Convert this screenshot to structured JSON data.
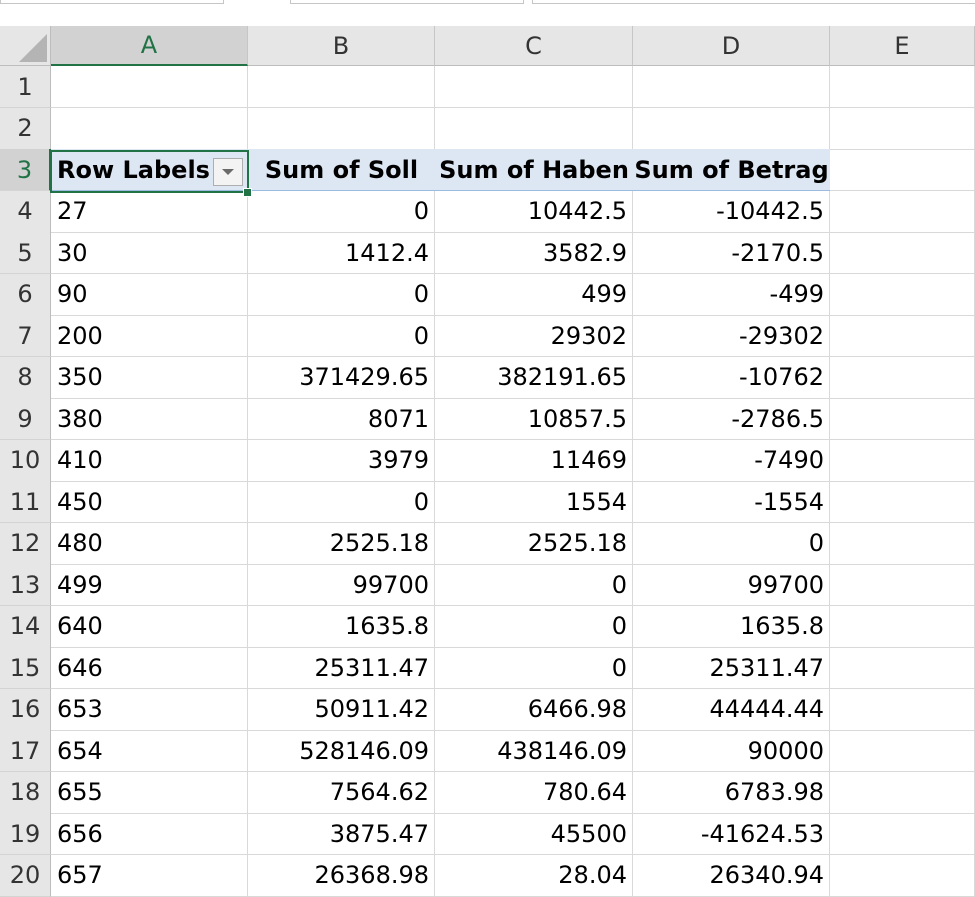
{
  "sheet": {
    "columns": [
      "A",
      "B",
      "C",
      "D",
      "E"
    ],
    "active_column": "A",
    "active_row": "3",
    "rows": [
      {
        "n": "1",
        "a": "",
        "b": "",
        "c": "",
        "d": ""
      },
      {
        "n": "2",
        "a": "",
        "b": "",
        "c": "",
        "d": ""
      },
      {
        "n": "3",
        "a": "Row Labels",
        "b": "Sum of Soll",
        "c": "Sum of Haben",
        "d": "Sum of Betrag"
      },
      {
        "n": "4",
        "a": "27",
        "b": "0",
        "c": "10442.5",
        "d": "-10442.5"
      },
      {
        "n": "5",
        "a": "30",
        "b": "1412.4",
        "c": "3582.9",
        "d": "-2170.5"
      },
      {
        "n": "6",
        "a": "90",
        "b": "0",
        "c": "499",
        "d": "-499"
      },
      {
        "n": "7",
        "a": "200",
        "b": "0",
        "c": "29302",
        "d": "-29302"
      },
      {
        "n": "8",
        "a": "350",
        "b": "371429.65",
        "c": "382191.65",
        "d": "-10762"
      },
      {
        "n": "9",
        "a": "380",
        "b": "8071",
        "c": "10857.5",
        "d": "-2786.5"
      },
      {
        "n": "10",
        "a": "410",
        "b": "3979",
        "c": "11469",
        "d": "-7490"
      },
      {
        "n": "11",
        "a": "450",
        "b": "0",
        "c": "1554",
        "d": "-1554"
      },
      {
        "n": "12",
        "a": "480",
        "b": "2525.18",
        "c": "2525.18",
        "d": "0"
      },
      {
        "n": "13",
        "a": "499",
        "b": "99700",
        "c": "0",
        "d": "99700"
      },
      {
        "n": "14",
        "a": "640",
        "b": "1635.8",
        "c": "0",
        "d": "1635.8"
      },
      {
        "n": "15",
        "a": "646",
        "b": "25311.47",
        "c": "0",
        "d": "25311.47"
      },
      {
        "n": "16",
        "a": "653",
        "b": "50911.42",
        "c": "6466.98",
        "d": "44444.44"
      },
      {
        "n": "17",
        "a": "654",
        "b": "528146.09",
        "c": "438146.09",
        "d": "90000"
      },
      {
        "n": "18",
        "a": "655",
        "b": "7564.62",
        "c": "780.64",
        "d": "6783.98"
      },
      {
        "n": "19",
        "a": "656",
        "b": "3875.47",
        "c": "45500",
        "d": "-41624.53"
      },
      {
        "n": "20",
        "a": "657",
        "b": "26368.98",
        "c": "28.04",
        "d": "26340.94"
      }
    ]
  },
  "icons": {
    "filter": "filter-dropdown-icon",
    "select_all": "select-all-icon"
  },
  "colors": {
    "accent": "#217346",
    "header_band": "#dde7f3",
    "grid": "#d9d9d9",
    "heading_bg": "#e6e6e6"
  }
}
